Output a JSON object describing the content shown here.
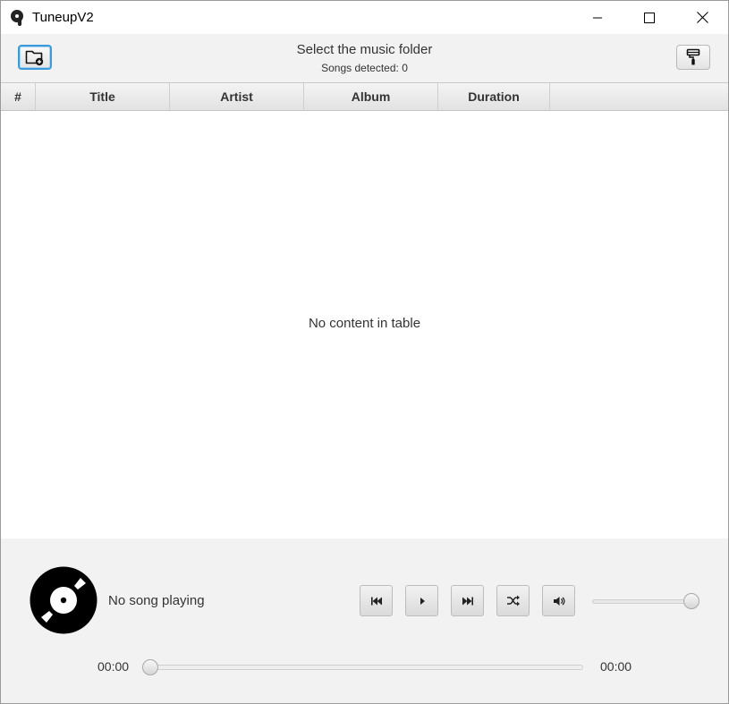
{
  "window": {
    "title": "TuneupV2"
  },
  "toolbar": {
    "heading": "Select the music folder",
    "songs_detected": "Songs detected: 0",
    "add_folder_icon": "folder-plus-icon",
    "theme_icon": "paint-roller-icon"
  },
  "table": {
    "columns": [
      "#",
      "Title",
      "Artist",
      "Album",
      "Duration"
    ],
    "rows": [],
    "empty_message": "No content in table"
  },
  "player": {
    "now_playing": "No song playing",
    "current_time": "00:00",
    "total_time": "00:00",
    "progress": 0,
    "volume": 1.0,
    "controls": [
      "previous-icon",
      "play-icon",
      "next-icon",
      "shuffle-icon",
      "volume-icon"
    ]
  },
  "colors": {
    "focus_accent": "#3b9ad9",
    "disc": "#000000"
  }
}
